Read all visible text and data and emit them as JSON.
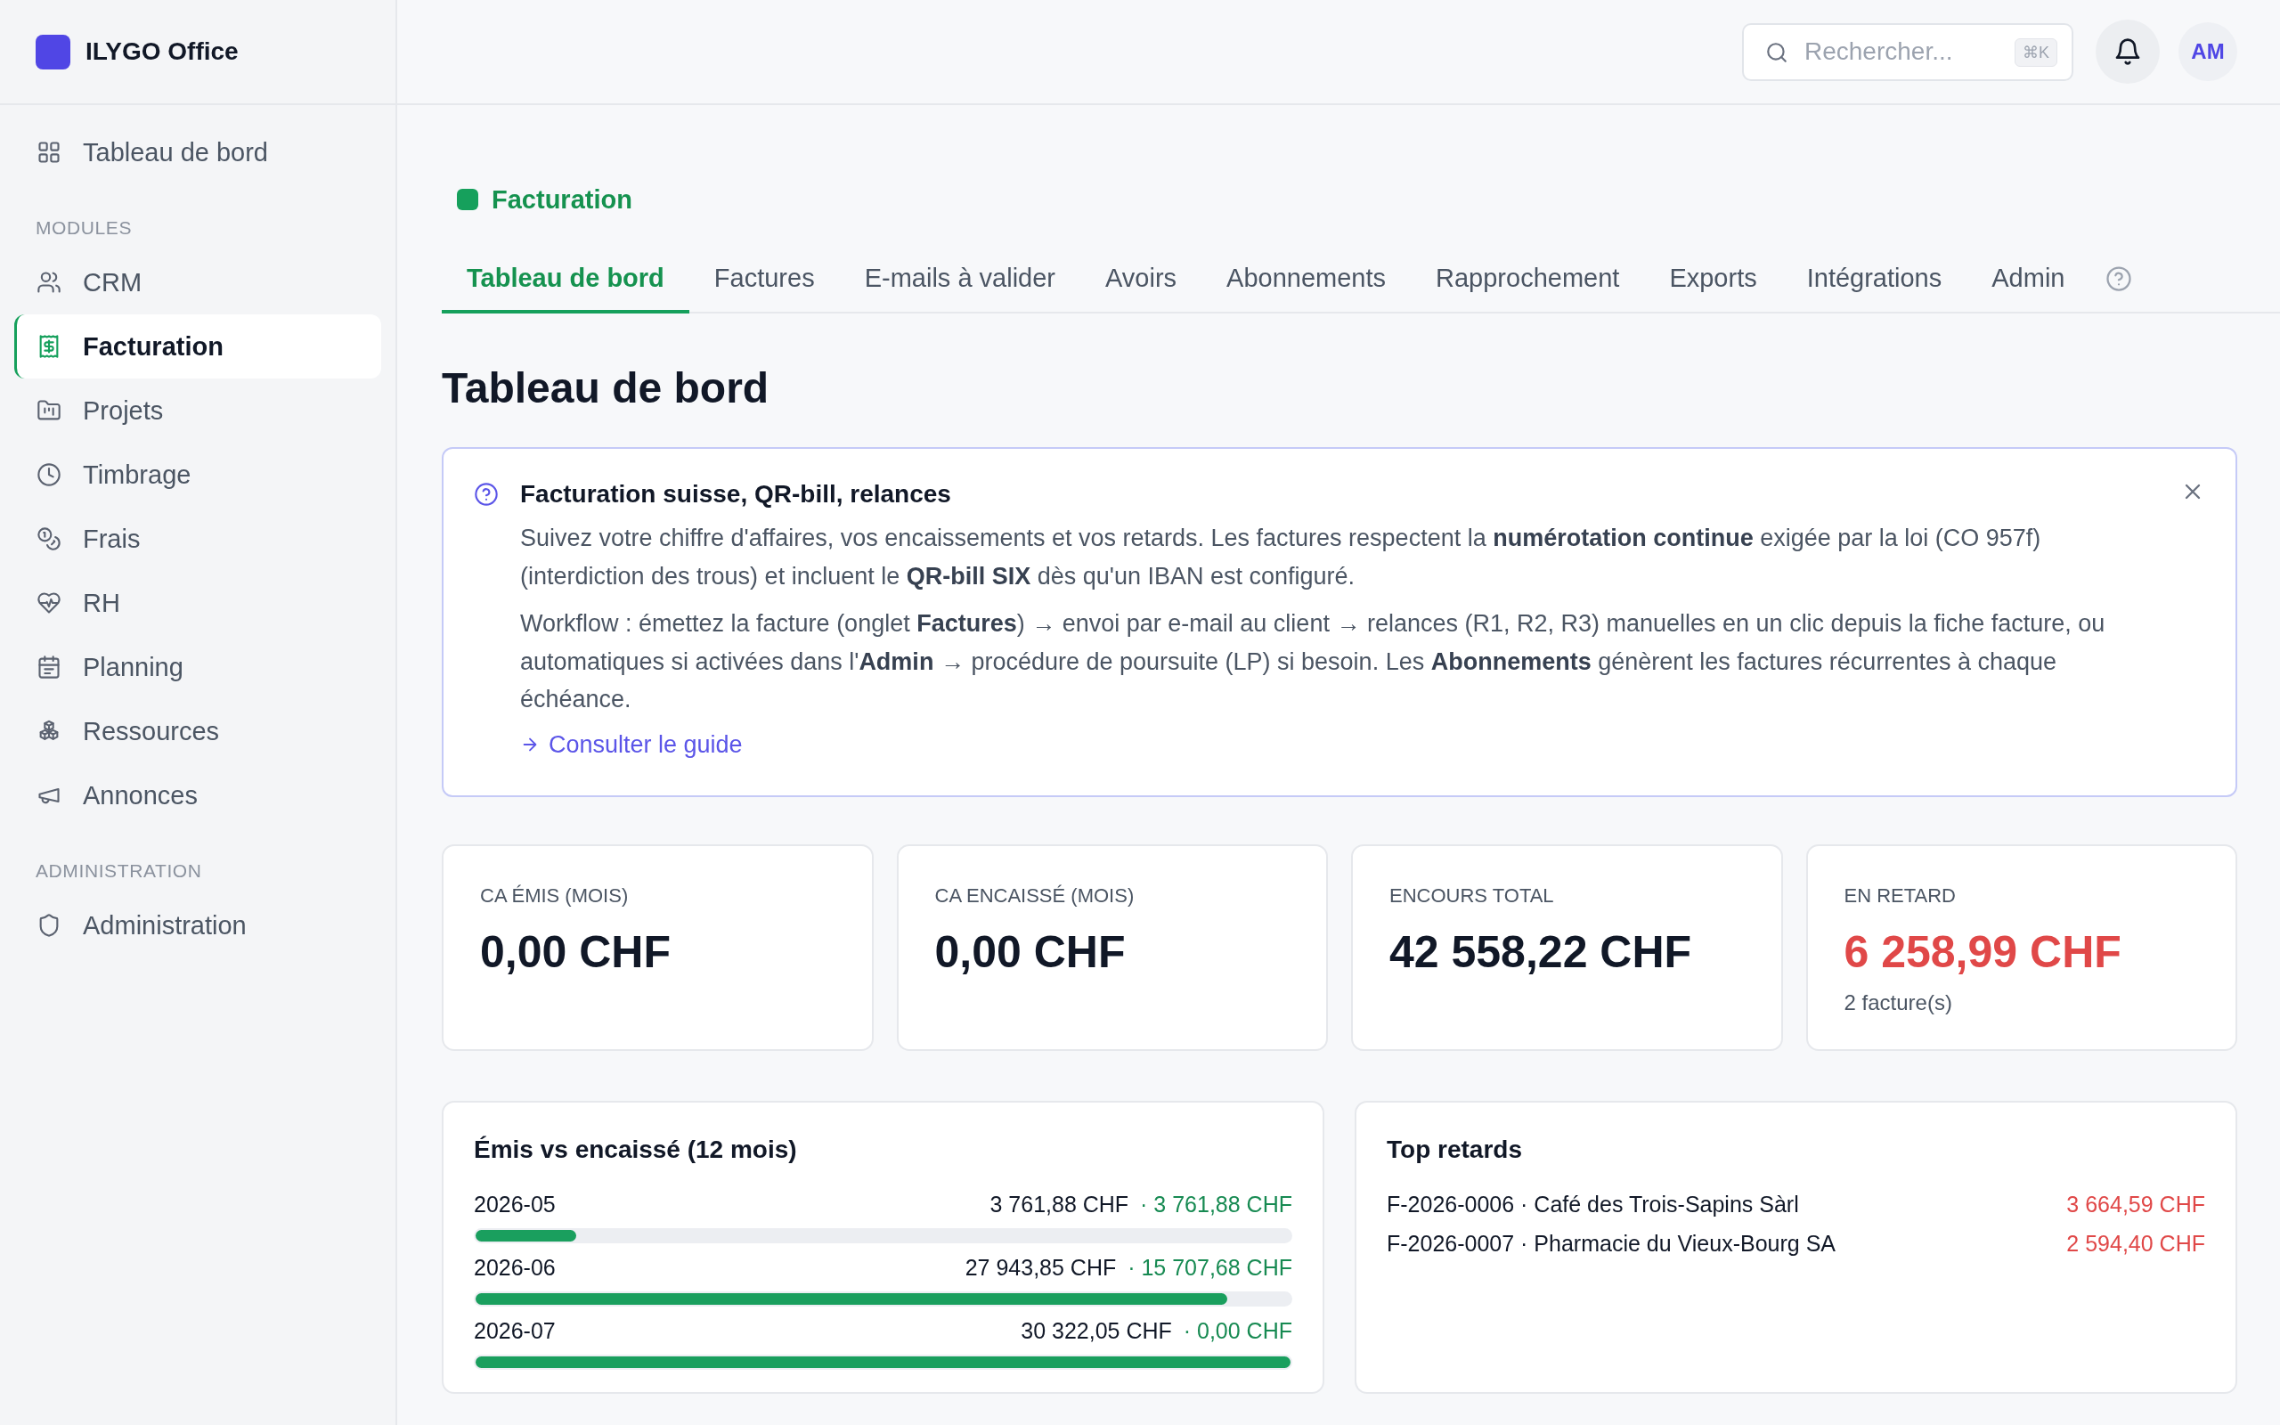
{
  "sidebar": {
    "brand": "ILYGO Office",
    "groups": [
      {
        "items": [
          {
            "label": "Tableau de bord",
            "selected": false
          }
        ]
      },
      {
        "heading": "MODULES",
        "items": [
          {
            "label": "CRM",
            "selected": false
          },
          {
            "label": "Facturation",
            "selected": true
          },
          {
            "label": "Projets",
            "selected": false
          },
          {
            "label": "Timbrage",
            "selected": false
          },
          {
            "label": "Frais",
            "selected": false
          },
          {
            "label": "RH",
            "selected": false
          },
          {
            "label": "Planning",
            "selected": false
          },
          {
            "label": "Ressources",
            "selected": false
          },
          {
            "label": "Annonces",
            "selected": false
          }
        ]
      },
      {
        "heading": "ADMINISTRATION",
        "items": [
          {
            "label": "Administration",
            "selected": false
          }
        ]
      }
    ]
  },
  "top_bar": {
    "search": {
      "placeholder": "Rechercher...",
      "shortcut": "⌘K"
    },
    "avatar_initials": "AM"
  },
  "module": {
    "title": "Facturation"
  },
  "tabs": [
    {
      "label": "Tableau de bord",
      "selected": true
    },
    {
      "label": "Factures",
      "selected": false
    },
    {
      "label": "E-mails à valider",
      "selected": false
    },
    {
      "label": "Avoirs",
      "selected": false
    },
    {
      "label": "Abonnements",
      "selected": false
    },
    {
      "label": "Rapprochement",
      "selected": false
    },
    {
      "label": "Exports",
      "selected": false
    },
    {
      "label": "Intégrations",
      "selected": false
    },
    {
      "label": "Admin",
      "selected": false
    }
  ],
  "page_title": "Tableau de bord",
  "info_box": {
    "title": "Facturation suisse, QR-bill, relances",
    "paragraphs": [
      "Suivez votre chiffre d'affaires, vos encaissements et vos retards. Les factures respectent la **numérotation continue** exigée par la loi (CO 957f) (interdiction des trous) et incluent le **QR-bill SIX** dès qu'un IBAN est configuré.",
      "Workflow : émettez la facture (onglet **Factures**) → envoi par e-mail au client → relances (R1, R2, R3) manuelles en un clic depuis la fiche facture, ou automatiques si activées dans l'**Admin** → procédure de poursuite (LP) si besoin. Les **Abonnements** génèrent les factures récurrentes à chaque échéance."
    ],
    "link": "Consulter le guide"
  },
  "kpis": [
    {
      "label": "CA ÉMIS (MOIS)",
      "value": "0,00 CHF",
      "alert": false
    },
    {
      "label": "CA ENCAISSÉ (MOIS)",
      "value": "0,00 CHF",
      "alert": false
    },
    {
      "label": "ENCOURS TOTAL",
      "value": "42 558,22 CHF",
      "alert": false
    },
    {
      "label": "EN RETARD",
      "value": "6 258,99 CHF",
      "alert": true,
      "note": "2 facture(s)"
    }
  ],
  "issued_vs_collected": {
    "title": "Émis vs encaissé (12 mois)",
    "rows": [
      {
        "month": "2026-05",
        "issued": "3 761,88 CHF",
        "collected": "· 3 761,88 CHF",
        "level": 0.124
      },
      {
        "month": "2026-06",
        "issued": "27 943,85 CHF",
        "collected": "· 15 707,68 CHF",
        "level": 0.922
      },
      {
        "month": "2026-07",
        "issued": "30 322,05 CHF",
        "collected": "· 0,00 CHF",
        "level": 1
      }
    ]
  },
  "top_overdue": {
    "title": "Top retards",
    "rows": [
      {
        "invoice": "F-2026-0006 · Café des Trois-Sapins Sàrl",
        "amount": "3 664,59 CHF"
      },
      {
        "invoice": "F-2026-0007 · Pharmacie du Vieux-Bourg SA",
        "amount": "2 594,40 CHF"
      }
    ]
  }
}
